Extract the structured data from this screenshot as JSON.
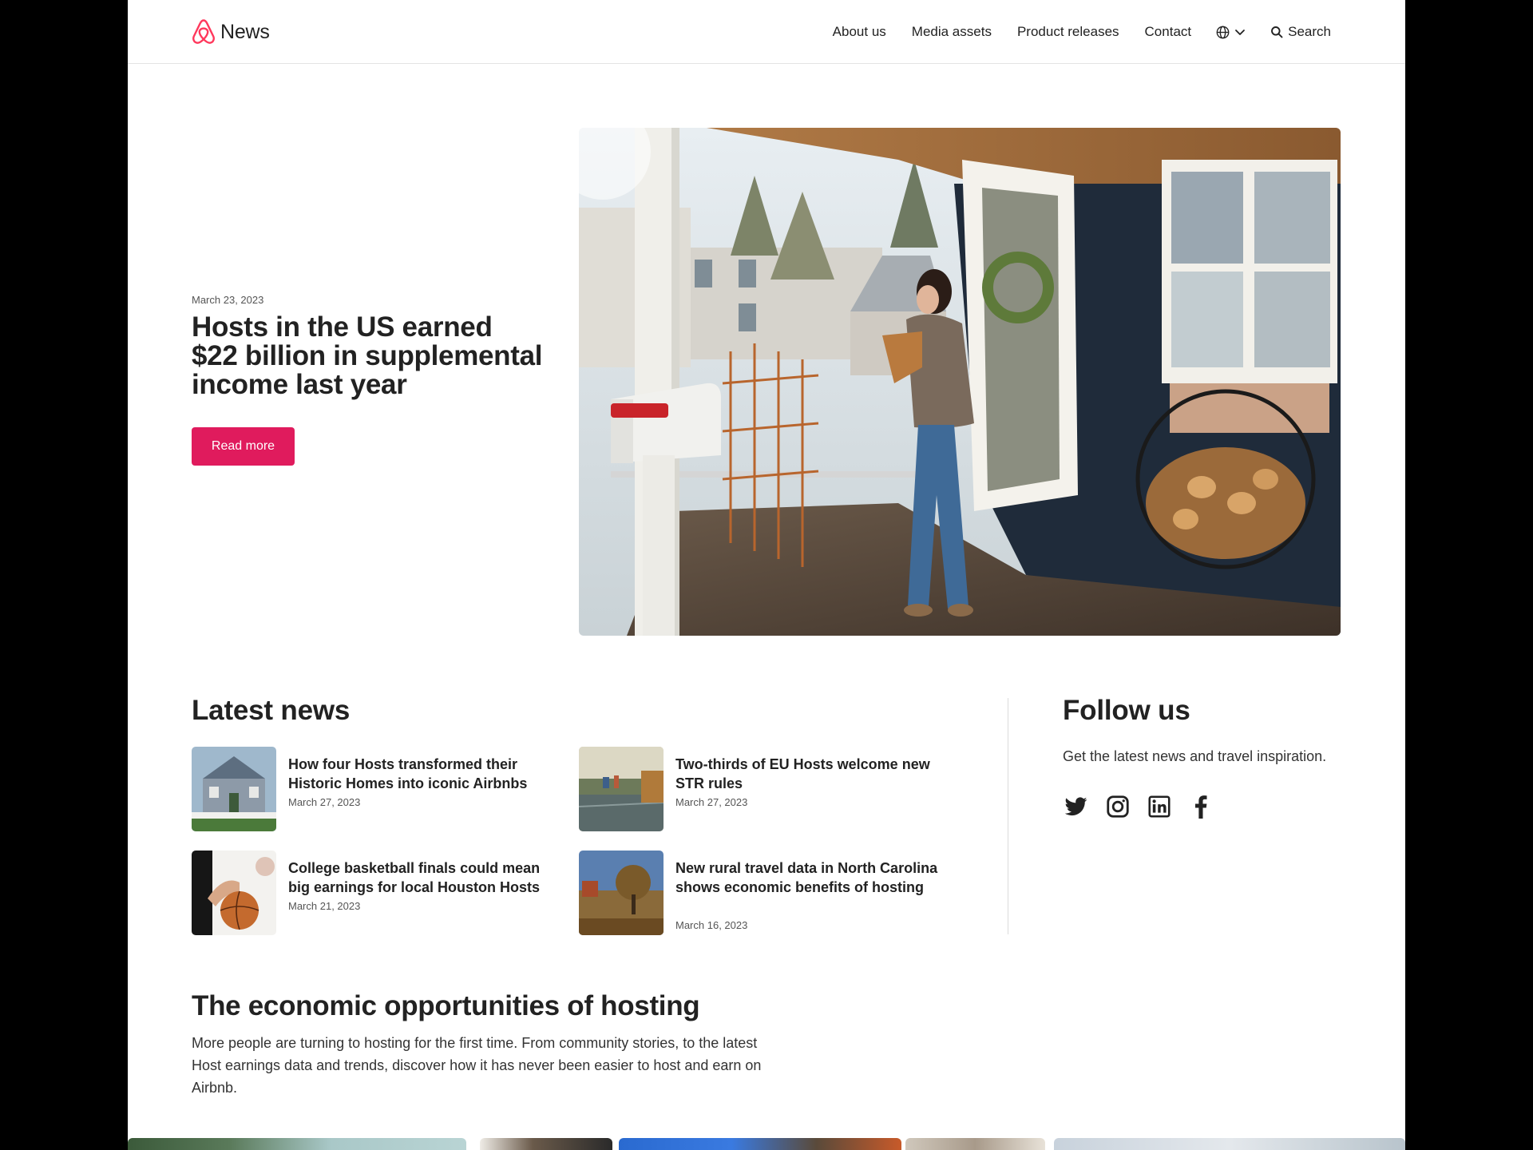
{
  "header": {
    "brand": "News",
    "nav": [
      "About us",
      "Media assets",
      "Product releases",
      "Contact"
    ],
    "search_label": "Search"
  },
  "hero": {
    "date": "March 23, 2023",
    "title": "Hosts in the US earned $22 billion in supplemental income last year",
    "cta": "Read more"
  },
  "latest": {
    "heading": "Latest news",
    "items": [
      {
        "title": "How four Hosts transformed their Historic Homes into iconic Airbnbs",
        "date": "March 27, 2023"
      },
      {
        "title": "Two-thirds of EU Hosts welcome new STR rules",
        "date": "March 27, 2023"
      },
      {
        "title": "College basketball finals could mean big earnings for local Houston Hosts",
        "date": "March 21, 2023"
      },
      {
        "title": "New rural travel data in North Carolina shows economic benefits of hosting",
        "date": "March 16, 2023"
      }
    ]
  },
  "follow": {
    "heading": "Follow us",
    "text": "Get the latest news and travel inspiration.",
    "icons": [
      "twitter-icon",
      "instagram-icon",
      "linkedin-icon",
      "facebook-icon"
    ]
  },
  "economic": {
    "heading": "The economic opportunities of hosting",
    "text": "More people are turning to hosting for the first time. From community stories, to the latest Host earnings data and trends, discover how it has never been easier to host and earn on Airbnb."
  },
  "colors": {
    "brand": "#FF385C",
    "button": "#E01B5D",
    "text": "#222222"
  }
}
